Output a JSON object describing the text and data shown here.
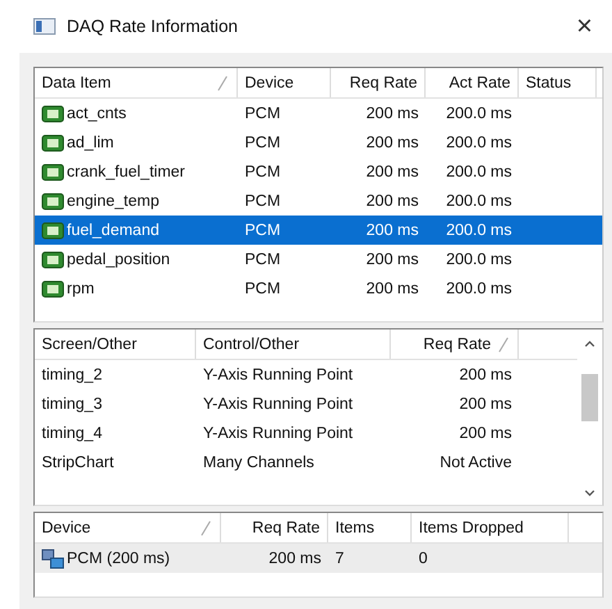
{
  "window": {
    "title": "DAQ Rate Information",
    "close": "×"
  },
  "data_items": {
    "columns": [
      {
        "label": "Data Item",
        "sorted": true
      },
      {
        "label": "Device",
        "sorted": false
      },
      {
        "label": "Req Rate",
        "sorted": false
      },
      {
        "label": "Act Rate",
        "sorted": false
      },
      {
        "label": "Status",
        "sorted": false
      }
    ],
    "rows": [
      {
        "cells": [
          "act_cnts",
          "PCM",
          "200 ms",
          "200.0 ms"
        ],
        "selected": false
      },
      {
        "cells": [
          "ad_lim",
          "PCM",
          "200 ms",
          "200.0 ms"
        ],
        "selected": false
      },
      {
        "cells": [
          "crank_fuel_timer",
          "PCM",
          "200 ms",
          "200.0 ms"
        ],
        "selected": false
      },
      {
        "cells": [
          "engine_temp",
          "PCM",
          "200 ms",
          "200.0 ms"
        ],
        "selected": false
      },
      {
        "cells": [
          "fuel_demand",
          "PCM",
          "200 ms",
          "200.0 ms"
        ],
        "selected": true
      },
      {
        "cells": [
          "pedal_position",
          "PCM",
          "200 ms",
          "200.0 ms"
        ],
        "selected": false
      },
      {
        "cells": [
          "rpm",
          "PCM",
          "200 ms",
          "200.0 ms"
        ],
        "selected": false
      }
    ]
  },
  "screens": {
    "columns": [
      {
        "label": "Screen/Other",
        "sorted": false
      },
      {
        "label": "Control/Other",
        "sorted": false
      },
      {
        "label": "Req Rate",
        "sorted": true
      }
    ],
    "rows": [
      {
        "cells": [
          "timing_2",
          "Y-Axis Running Point",
          "200 ms"
        ],
        "selected": false
      },
      {
        "cells": [
          "timing_3",
          "Y-Axis Running Point",
          "200 ms"
        ],
        "selected": false
      },
      {
        "cells": [
          "timing_4",
          "Y-Axis Running Point",
          "200 ms"
        ],
        "selected": false
      },
      {
        "cells": [
          "StripChart",
          "Many Channels",
          "Not Active"
        ],
        "selected": false
      }
    ]
  },
  "devices": {
    "columns": [
      {
        "label": "Device",
        "sorted": true
      },
      {
        "label": "Req Rate",
        "sorted": false
      },
      {
        "label": "Items",
        "sorted": false
      },
      {
        "label": "Items Dropped",
        "sorted": false
      }
    ],
    "rows": [
      {
        "cells": [
          "PCM (200 ms)",
          "200 ms",
          "7",
          "0"
        ],
        "selected": true
      }
    ]
  }
}
